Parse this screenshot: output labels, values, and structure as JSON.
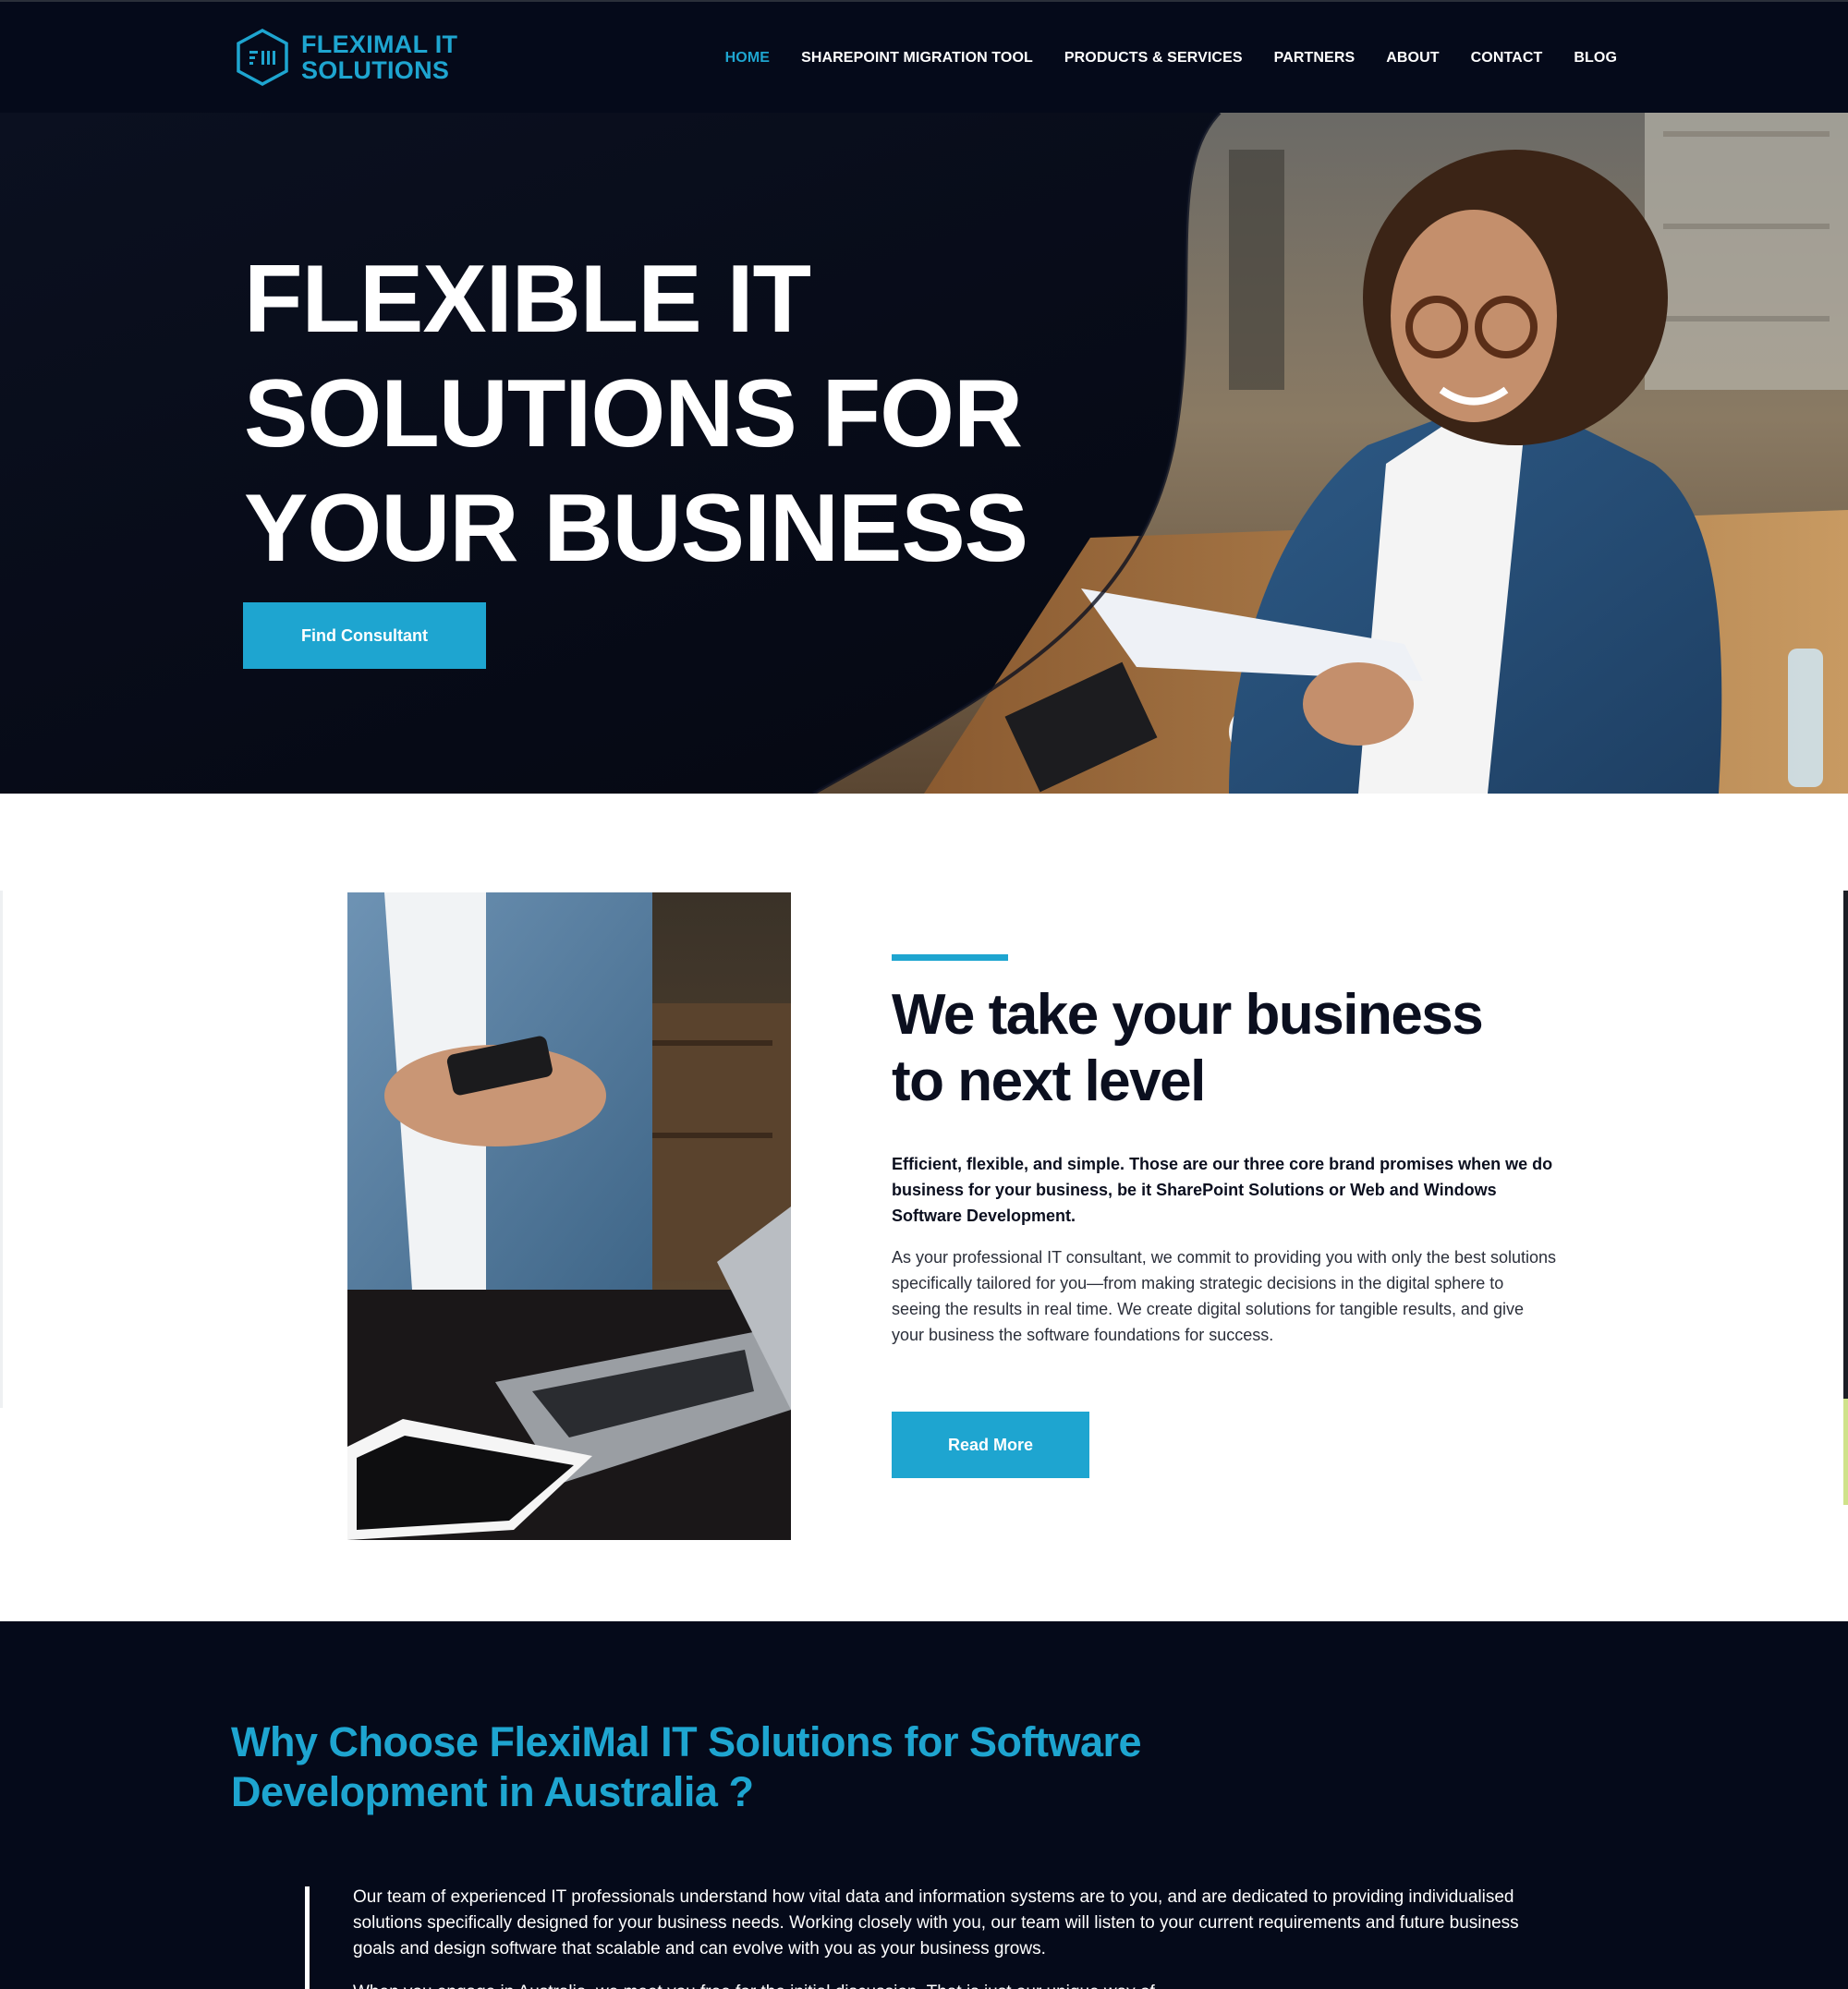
{
  "brand": {
    "line1": "FLEXIMAL IT",
    "line2": "SOLUTIONS",
    "accent": "#1ea5d0",
    "dark": "#050a1a"
  },
  "nav": {
    "items": [
      {
        "label": "HOME",
        "active": true
      },
      {
        "label": "SHAREPOINT MIGRATION TOOL",
        "active": false
      },
      {
        "label": "PRODUCTS & SERVICES",
        "active": false
      },
      {
        "label": "PARTNERS",
        "active": false
      },
      {
        "label": "ABOUT",
        "active": false
      },
      {
        "label": "CONTACT",
        "active": false
      },
      {
        "label": "BLOG",
        "active": false
      }
    ]
  },
  "hero": {
    "title_lines": [
      "FLEXIBLE IT",
      "SOLUTIONS FOR",
      "YOUR BUSINESS"
    ],
    "cta_label": "Find Consultant"
  },
  "about": {
    "title_lines": [
      "We take your business",
      "to next level"
    ],
    "lead": "Efficient, flexible, and simple. Those are our three core brand promises when we do business for your business, be it SharePoint Solutions or Web and Windows Software Development.",
    "body": "As your professional IT consultant, we commit to providing you with only the best solutions specifically tailored for you—from making strategic decisions in the digital sphere to seeing the results in real time. We create digital solutions for tangible results, and give your business the software foundations for success.",
    "cta_label": "Read More"
  },
  "why": {
    "title_lines": [
      "Why Choose FlexiMal IT Solutions for Software",
      "Development in Australia ?"
    ],
    "body": "Our team of experienced IT professionals understand how vital data and information systems are to you, and are dedicated to providing individualised solutions specifically designed for your business needs. Working closely with you, our team will listen to your current requirements and future business goals and design software that scalable and can evolve with you as your business grows.",
    "body_2": "When you engage in Australia, we meet you free for the initial discussion. That is just our unique way of"
  }
}
